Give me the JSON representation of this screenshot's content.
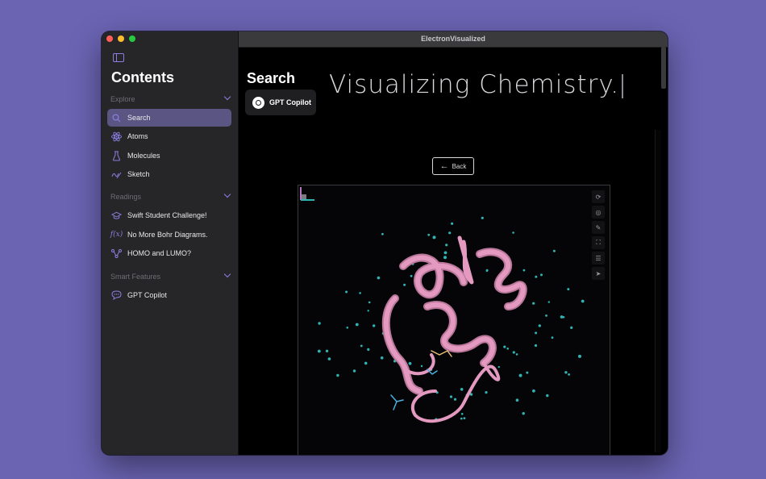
{
  "window": {
    "title": "ElectronVisualized"
  },
  "sidebar": {
    "title": "Contents",
    "sections": [
      {
        "label": "Explore",
        "items": [
          {
            "label": "Search",
            "icon": "magnifier-icon",
            "active": true
          },
          {
            "label": "Atoms",
            "icon": "atom-icon"
          },
          {
            "label": "Molecules",
            "icon": "flask-icon"
          },
          {
            "label": "Sketch",
            "icon": "scribble-icon"
          }
        ]
      },
      {
        "label": "Readings",
        "items": [
          {
            "label": "Swift Student Challenge!",
            "icon": "graduation-cap-icon"
          },
          {
            "label": "No More Bohr Diagrams.",
            "icon": "function-icon"
          },
          {
            "label": "HOMO and LUMO?",
            "icon": "graph-nodes-icon"
          }
        ]
      },
      {
        "label": "Smart Features",
        "items": [
          {
            "label": "GPT Copilot",
            "icon": "chat-bubble-icon"
          }
        ]
      }
    ]
  },
  "main": {
    "title": "Search",
    "copilot_button": "GPT Copilot",
    "headline": "Visualizing Chemistry.",
    "back_button": "Back"
  },
  "colors": {
    "accent": "#8a7fe0",
    "active_item": "#5a5583",
    "protein": "#e49ac0",
    "water": "#2fb3b3"
  }
}
